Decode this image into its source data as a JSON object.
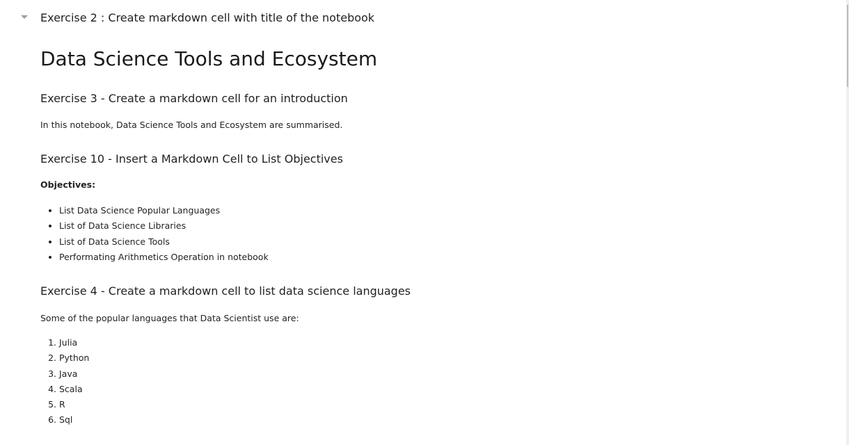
{
  "cells": {
    "exercise2_heading": "Exercise 2 : Create markdown cell with title of the notebook",
    "title": "Data Science Tools and Ecosystem",
    "exercise3_heading": "Exercise 3 - Create a markdown cell for an introduction",
    "intro_text": "In this notebook, Data Science Tools and Ecosystem are summarised.",
    "exercise10_heading": "Exercise 10 - Insert a Markdown Cell to List Objectives",
    "objectives_label": "Objectives:",
    "objectives": [
      "List Data Science Popular Languages",
      "List of Data Science Libraries",
      "List of Data Science Tools",
      "Performating Arithmetics Operation in notebook"
    ],
    "exercise4_heading": "Exercise 4 - Create a markdown cell to list data science languages",
    "languages_intro": "Some of the popular languages that Data Scientist use are:",
    "languages": [
      "Julia",
      "Python",
      "Java",
      "Scala",
      "R",
      "Sql"
    ]
  },
  "icons": {
    "collapse": "caret-down-icon"
  }
}
